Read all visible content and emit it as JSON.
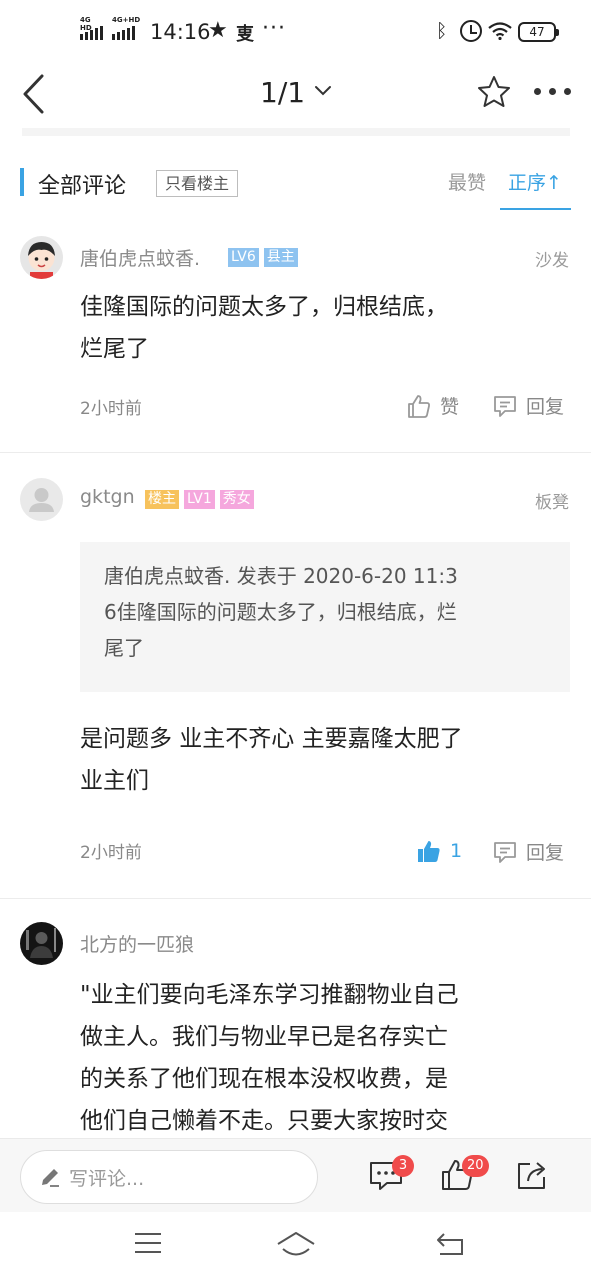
{
  "status_bar": {
    "signal1_label": "4G HD",
    "signal2_label": "4G+HD",
    "time": "14:16",
    "app_icon_text": "叓",
    "more": "···",
    "battery": "47"
  },
  "nav": {
    "title": "1/1"
  },
  "comments_header": {
    "title": "全部评论",
    "only_op": "只看楼主",
    "sort_top": "最赞",
    "sort_order": "正序↑"
  },
  "comments": [
    {
      "user": "唐伯虎点蚊香.",
      "badges": [
        "LV6",
        "县主"
      ],
      "badge_colors": [
        "#8ec3f0",
        "#8ec3f0"
      ],
      "floor": "沙发",
      "text_line1": "佳隆国际的问题太多了，归根结底，",
      "text_line2": "烂尾了",
      "time": "2小时前",
      "like_label": "赞",
      "reply_label": "回复"
    },
    {
      "user": "gktgn",
      "badges": [
        "楼主",
        "LV1",
        "秀女"
      ],
      "badge_colors": [
        "#f7c25c",
        "#f5a7dd",
        "#f5a7dd"
      ],
      "floor": "板凳",
      "quote_line1": "唐伯虎点蚊香. 发表于 2020-6-20 11:3",
      "quote_line2": "6佳隆国际的问题太多了，归根结底，烂",
      "quote_line3": "尾了",
      "text_line1": "是问题多 业主不齐心 主要嘉隆太肥了",
      "text_line2": "业主们",
      "time": "2小时前",
      "like_count": "1",
      "reply_label": "回复"
    },
    {
      "user": "北方的一匹狼",
      "text_line1": "\"业主们要向毛泽东学习推翻物业自己",
      "text_line2": "做主人。我们与物业早已是名存实亡",
      "text_line3": "的关系了他们现在根本没权收费，是",
      "text_line4": "他们自己懒着不走。只要大家按时交"
    }
  ],
  "bottom_bar": {
    "write_placeholder": "写评论...",
    "comment_count": "3",
    "like_count": "20"
  },
  "colors": {
    "accent": "#3aa3e3",
    "like_active": "#3aa3e3",
    "badge_red": "#f04b4b"
  }
}
